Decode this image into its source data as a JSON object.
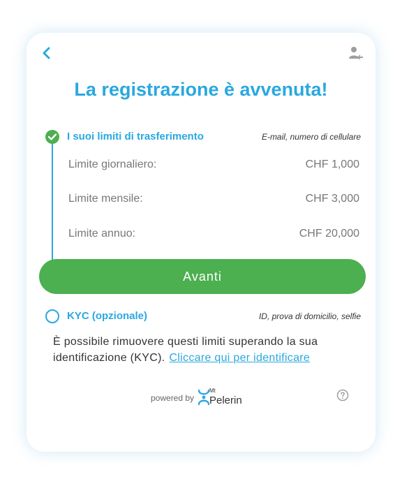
{
  "header": {
    "back_icon": "chevron-left-icon",
    "account_icon": "user-arrow-icon",
    "title": "La registrazione è avvenuta!"
  },
  "steps": {
    "limits": {
      "title": "I suoi limiti di trasferimento",
      "subtitle": "E-mail, numero di cellulare",
      "status": "completed",
      "rows": [
        {
          "label": "Limite giornaliero:",
          "value": "CHF 1,000"
        },
        {
          "label": "Limite mensile:",
          "value": "CHF 3,000"
        },
        {
          "label": "Limite annuo:",
          "value": "CHF 20,000"
        }
      ]
    },
    "kyc": {
      "title": "KYC (opzionale)",
      "subtitle": "ID, prova di domicilio, selfie",
      "status": "pending"
    }
  },
  "actions": {
    "next_label": "Avanti"
  },
  "kyc_info": {
    "text": "È possibile rimuovere questi limiti superando la sua identificazione (KYC).",
    "link": "Cliccare qui per identificare"
  },
  "footer": {
    "powered_by": "powered by",
    "brand_mt": "Mt",
    "brand_name": "Pelerin",
    "help_icon": "question-circle-icon"
  },
  "colors": {
    "accent": "#2aa8e0",
    "success": "#4caf50"
  }
}
